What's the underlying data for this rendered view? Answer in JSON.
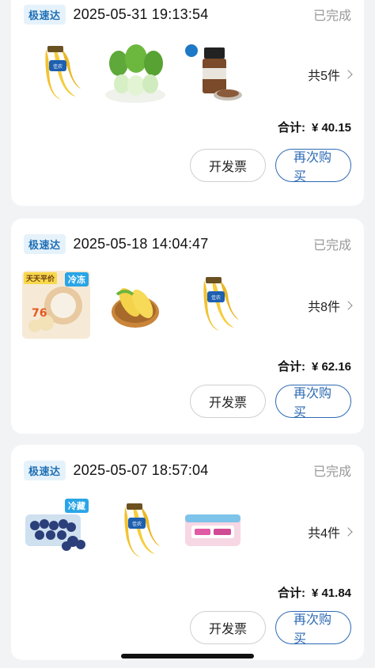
{
  "orders": [
    {
      "badge": "极速达",
      "time": "2025-05-31 19:13:54",
      "status": "已完成",
      "items": [
        "banana-icon",
        "bok-choy-icon",
        "seasoning-jar-icon"
      ],
      "count": "共5件",
      "total_label": "合计:",
      "total_amount": "¥ 40.15",
      "invoice_label": "开发票",
      "rebuy_label": "再次购买"
    },
    {
      "badge": "极速达",
      "time": "2025-05-18 14:04:47",
      "status": "已完成",
      "items": [
        "pastry-icon",
        "corn-icon",
        "banana-icon"
      ],
      "item_tags": {
        "pastry_promo": "天天平价",
        "pastry_frozen": "冷冻"
      },
      "count": "共8件",
      "total_label": "合计:",
      "total_amount": "¥ 62.16",
      "invoice_label": "开发票",
      "rebuy_label": "再次购买"
    },
    {
      "badge": "极速达",
      "time": "2025-05-07 18:57:04",
      "status": "已完成",
      "items": [
        "blueberry-icon",
        "banana-icon",
        "pad-pack-icon"
      ],
      "item_tags": {
        "blueberry_chill": "冷藏"
      },
      "count": "共4件",
      "total_label": "合计:",
      "total_amount": "¥ 41.84",
      "invoice_label": "开发票",
      "rebuy_label": "再次购买"
    }
  ],
  "colors": {
    "accent": "#2c6ab3",
    "badge_bg": "#e6f2fb",
    "status": "#999999",
    "page_bg": "#f2f3f5"
  }
}
